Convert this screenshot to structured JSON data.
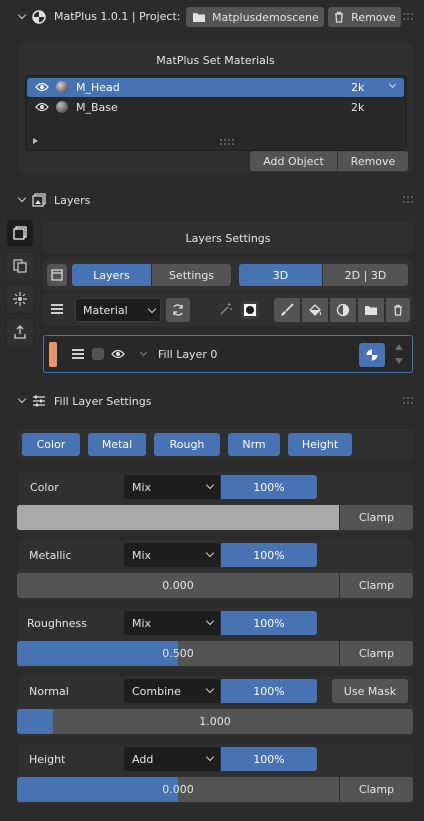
{
  "header": {
    "title": "MatPlus 1.0.1 | Project:",
    "project_name": "Matplusdemoscene",
    "remove_label": "Remove"
  },
  "materials": {
    "title": "MatPlus Set Materials",
    "items": [
      {
        "name": "M_Head",
        "res": "2k"
      },
      {
        "name": "M_Base",
        "res": "2k"
      }
    ],
    "add_object_label": "Add Object",
    "remove_label": "Remove"
  },
  "layers": {
    "section_title": "Layers",
    "settings_title": "Layers Settings",
    "tab_layers": "Layers",
    "tab_settings": "Settings",
    "view_3d": "3D",
    "view_2d3d": "2D | 3D",
    "material_select": "Material",
    "layer_name": "Fill Layer 0"
  },
  "fill": {
    "section_title": "Fill Layer Settings",
    "channel_buttons": [
      "Color",
      "Metal",
      "Rough",
      "Nrm",
      "Height"
    ],
    "color": {
      "label": "Color",
      "blend": "Mix",
      "opacity": "100%",
      "clamp": "Clamp",
      "swatch": "#a9a9a9"
    },
    "metallic": {
      "label": "Metallic",
      "blend": "Mix",
      "opacity": "100%",
      "value": "0.000",
      "fill": 0.0,
      "clamp": "Clamp"
    },
    "roughness": {
      "label": "Roughness",
      "blend": "Mix",
      "opacity": "100%",
      "value": "0.500",
      "fill": 0.5,
      "clamp": "Clamp"
    },
    "normal": {
      "label": "Normal",
      "blend": "Combine",
      "opacity": "100%",
      "use_mask": "Use Mask",
      "value": "1.000",
      "fill": 0.09
    },
    "height": {
      "label": "Height",
      "blend": "Add",
      "opacity": "100%",
      "value": "0.000",
      "fill": 0.5,
      "clamp": "Clamp"
    }
  },
  "colors": {
    "accent": "#4772b3",
    "layer_color_tag": "#e8956d"
  }
}
